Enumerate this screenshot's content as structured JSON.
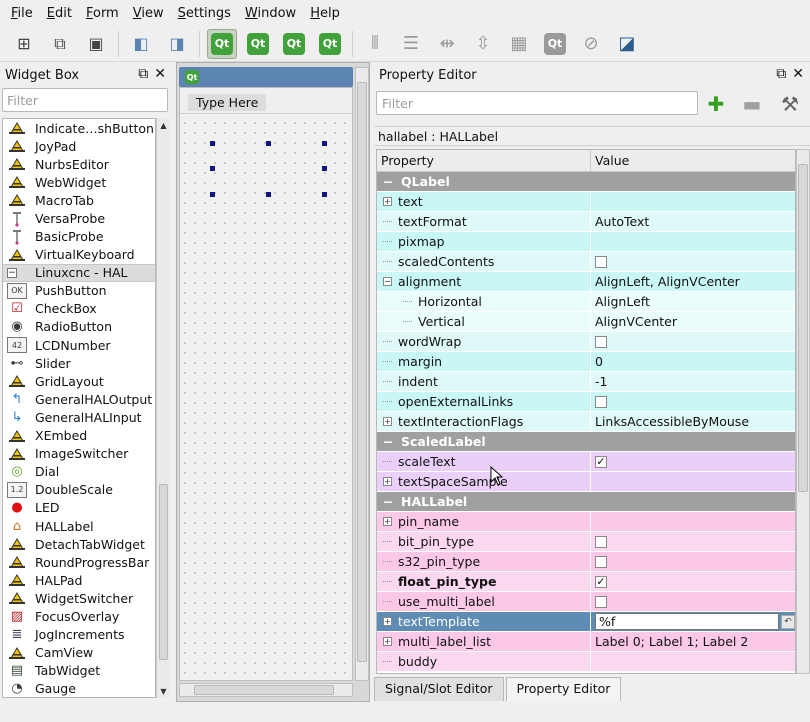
{
  "menubar": [
    {
      "first": "F",
      "rest": "ile"
    },
    {
      "first": "E",
      "rest": "dit"
    },
    {
      "first": "F",
      "rest": "orm"
    },
    {
      "first": "V",
      "rest": "iew"
    },
    {
      "first": "S",
      "rest": "ettings"
    },
    {
      "first": "W",
      "rest": "indow"
    },
    {
      "first": "H",
      "rest": "elp"
    }
  ],
  "toolbar": {
    "qt_label": "Qt"
  },
  "widget_box": {
    "title": "Widget Box",
    "filter_placeholder": "Filter",
    "items_top": [
      {
        "label": "Indicate…shButton",
        "icon": "hat-icon"
      },
      {
        "label": "JoyPad",
        "icon": "hat-icon"
      },
      {
        "label": "NurbsEditor",
        "icon": "hat-icon"
      },
      {
        "label": "WebWidget",
        "icon": "hat-icon"
      },
      {
        "label": "MacroTab",
        "icon": "hat-icon"
      },
      {
        "label": "VersaProbe",
        "icon": "probe-icon"
      },
      {
        "label": "BasicProbe",
        "icon": "probe-icon"
      },
      {
        "label": "VirtualKeyboard",
        "icon": "hat-icon"
      }
    ],
    "category": "Linuxcnc - HAL",
    "items_hal": [
      {
        "label": "PushButton",
        "icon": "ok-button-icon",
        "glyph": "OK"
      },
      {
        "label": "CheckBox",
        "icon": "checkbox-icon",
        "glyph": "☑"
      },
      {
        "label": "RadioButton",
        "icon": "radio-icon",
        "glyph": "◉"
      },
      {
        "label": "LCDNumber",
        "icon": "lcd-icon",
        "glyph": "42"
      },
      {
        "label": "Slider",
        "icon": "slider-icon",
        "glyph": "⊷"
      },
      {
        "label": "GridLayout",
        "icon": "hat-icon",
        "glyph": "▲"
      },
      {
        "label": "GeneralHALOutput",
        "icon": "arrow-out-icon",
        "glyph": "↰"
      },
      {
        "label": "GeneralHALInput",
        "icon": "arrow-in-icon",
        "glyph": "↳"
      },
      {
        "label": "XEmbed",
        "icon": "hat-icon",
        "glyph": "▲"
      },
      {
        "label": "ImageSwitcher",
        "icon": "hat-icon",
        "glyph": "▲"
      },
      {
        "label": "Dial",
        "icon": "dial-icon",
        "glyph": "◎"
      },
      {
        "label": "DoubleScale",
        "icon": "spinbox-icon",
        "glyph": "1.2"
      },
      {
        "label": "LED",
        "icon": "led-icon",
        "glyph": "●"
      },
      {
        "label": "HALLabel",
        "icon": "label-tag-icon",
        "glyph": "⌂"
      },
      {
        "label": "DetachTabWidget",
        "icon": "hat-icon",
        "glyph": "▲"
      },
      {
        "label": "RoundProgressBar",
        "icon": "hat-icon",
        "glyph": "▲"
      },
      {
        "label": "HALPad",
        "icon": "hat-icon",
        "glyph": "▲"
      },
      {
        "label": "WidgetSwitcher",
        "icon": "hat-icon",
        "glyph": "▲"
      },
      {
        "label": "FocusOverlay",
        "icon": "overlay-icon",
        "glyph": "▨"
      },
      {
        "label": "JogIncrements",
        "icon": "list-icon",
        "glyph": "≣"
      },
      {
        "label": "CamView",
        "icon": "hat-icon",
        "glyph": "▲"
      },
      {
        "label": "TabWidget",
        "icon": "tabwidget-icon",
        "glyph": "▤"
      },
      {
        "label": "Gauge",
        "icon": "gauge-icon",
        "glyph": "◔"
      }
    ]
  },
  "form": {
    "type_here": "Type Here"
  },
  "property_editor": {
    "title": "Property Editor",
    "filter_placeholder": "Filter",
    "object_label": "hallabel : HALLabel",
    "col_property": "Property",
    "col_value": "Value",
    "rows": [
      {
        "kind": "section",
        "name": "QLabel",
        "bg": "section"
      },
      {
        "kind": "expand",
        "name": "text",
        "value": "",
        "bg": "bg-cyan"
      },
      {
        "kind": "leaf",
        "name": "textFormat",
        "value": "AutoText",
        "bg": "bg-cyan2"
      },
      {
        "kind": "leaf",
        "name": "pixmap",
        "value": "",
        "bg": "bg-cyan"
      },
      {
        "kind": "leaf",
        "name": "scaledContents",
        "value": "",
        "check": false,
        "bg": "bg-cyan2"
      },
      {
        "kind": "collapse",
        "name": "alignment",
        "value": "AlignLeft, AlignVCenter",
        "bg": "bg-cyan"
      },
      {
        "kind": "sub",
        "name": "Horizontal",
        "value": "AlignLeft",
        "bg": "bg-cyanl"
      },
      {
        "kind": "sub",
        "name": "Vertical",
        "value": "AlignVCenter",
        "bg": "bg-cyanl"
      },
      {
        "kind": "leaf",
        "name": "wordWrap",
        "value": "",
        "check": false,
        "bg": "bg-cyan2"
      },
      {
        "kind": "leaf",
        "name": "margin",
        "value": "0",
        "bg": "bg-cyan"
      },
      {
        "kind": "leaf",
        "name": "indent",
        "value": "-1",
        "bg": "bg-cyan2"
      },
      {
        "kind": "leaf",
        "name": "openExternalLinks",
        "value": "",
        "check": false,
        "bg": "bg-cyan"
      },
      {
        "kind": "expand",
        "name": "textInteractionFlags",
        "value": "LinksAccessibleByMouse",
        "bg": "bg-cyan2"
      },
      {
        "kind": "section",
        "name": "ScaledLabel",
        "bg": "section"
      },
      {
        "kind": "leaf",
        "name": "scaleText",
        "value": "",
        "check": true,
        "bg": "bg-vio"
      },
      {
        "kind": "expand",
        "name": "textSpaceSample",
        "value": "",
        "bg": "bg-vio"
      },
      {
        "kind": "section",
        "name": "HALLabel",
        "bg": "section"
      },
      {
        "kind": "expand",
        "name": "pin_name",
        "value": "",
        "bg": "bg-pink"
      },
      {
        "kind": "leaf",
        "name": "bit_pin_type",
        "value": "",
        "check": false,
        "bg": "bg-pink2"
      },
      {
        "kind": "leaf",
        "name": "s32_pin_type",
        "value": "",
        "check": false,
        "bg": "bg-pink"
      },
      {
        "kind": "leaf",
        "name": "float_pin_type",
        "value": "",
        "check": true,
        "bold": true,
        "bg": "bg-pink2"
      },
      {
        "kind": "leaf",
        "name": "use_multi_label",
        "value": "",
        "check": false,
        "bg": "bg-pink"
      },
      {
        "kind": "expand",
        "name": "textTemplate",
        "value": "%f",
        "selected": true,
        "bg": "selected"
      },
      {
        "kind": "expand",
        "name": "multi_label_list",
        "value": "Label 0; Label 1; Label 2",
        "bg": "bg-pink"
      },
      {
        "kind": "leaf",
        "name": "buddy",
        "value": "",
        "bg": "bg-pink2"
      }
    ]
  },
  "tabs": [
    {
      "label": "Signal/Slot Editor",
      "active": false
    },
    {
      "label": "Property Editor",
      "active": true
    }
  ]
}
